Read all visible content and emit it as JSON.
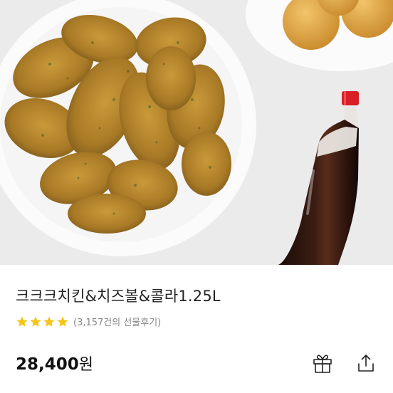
{
  "product": {
    "title": "크크크치킨&치즈볼&콜라1.25L",
    "rating_stars": 4,
    "review_text": "(3,157건의 선물후기)",
    "price_amount": "28,400",
    "price_unit": "원"
  },
  "actions": {
    "gift_icon": "gift-icon",
    "share_icon": "share-icon"
  },
  "colors": {
    "star": "#f5c518",
    "background_hero": "#ebebeb",
    "text_primary": "#222222",
    "text_secondary": "#888888",
    "bottle_cap": "#d81f26"
  }
}
